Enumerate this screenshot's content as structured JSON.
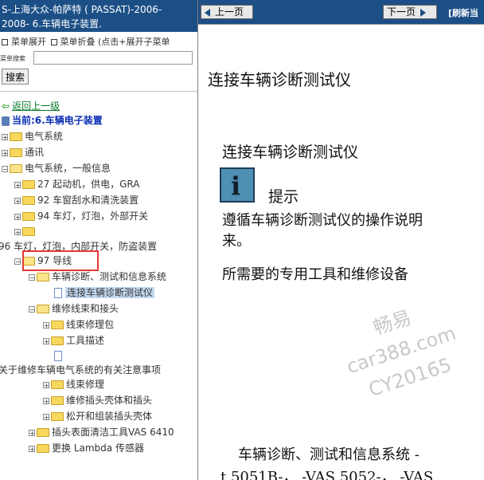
{
  "left_pane": {
    "title_line1": "S-上海大众-帕萨特 ( PASSAT)-2006-",
    "title_line2": "2008- 6.车辆电子装置.",
    "menu_expand": "菜单展开",
    "menu_collapse": "菜单折叠 (点击+展开子菜单",
    "search_label": "菜单搜索",
    "search_value": "",
    "search_button": "搜索",
    "back_link": "返回上一级",
    "current_label": "当前:6.车辆电子装置",
    "tree": {
      "electrical_system": "电气系统",
      "communication": "通讯",
      "electrical_general": "电气系统，一般信息",
      "item27": "27 起动机，供电，GRA",
      "item92": "92 车窗刮水和清洗装置",
      "item94": "94 车灯，灯泡，外部开关",
      "item96": "96 车灯，灯泡，内部开关，防盗装置",
      "item97": "97 导线",
      "diag": "车辆诊断、测试和信息系统",
      "connect_diag": "连接车辆诊断测试仪",
      "harness": "维修线束和接头",
      "harness_kit": "线束修理包",
      "tool_desc": "工具描述",
      "notes": "关于维修车辆电气系统的有关注意事项",
      "wire_repair": "线束修理",
      "plug_housing": "维修插头壳体和插头",
      "loosen_plug": "松开和组装插头壳体",
      "cleaning_tool": "插头表面清洁工具VAS 6410",
      "lambda": "更换 Lambda 传感器"
    }
  },
  "right_pane": {
    "prev_button": "上一页",
    "next_button": "下一页",
    "refresh_label": "[刷新当",
    "page_heading": "连接车辆诊断测试仪",
    "sub_heading": "连接车辆诊断测试仪",
    "info_icon_letter": "i",
    "hint_label": "提示",
    "body_line1": "遵循车辆诊断测试仪的操作说明",
    "body_line2": "来。",
    "body_line3": "所需要的专用工具和维修设备",
    "body_line4": "车辆诊断、测试和信息系统 -",
    "body_line5": "t 5051B-， -VAS 5052-， -VAS",
    "watermark_line1": "畅易",
    "watermark_line2": "car388.com",
    "watermark_line3": "CY20165"
  },
  "colors": {
    "header_blue": "#1c4f86",
    "link_green": "#0a7a2a",
    "current_blue": "#0b2fb5",
    "highlight_red": "#e53935",
    "folder_yellow": "#f7d75c"
  }
}
